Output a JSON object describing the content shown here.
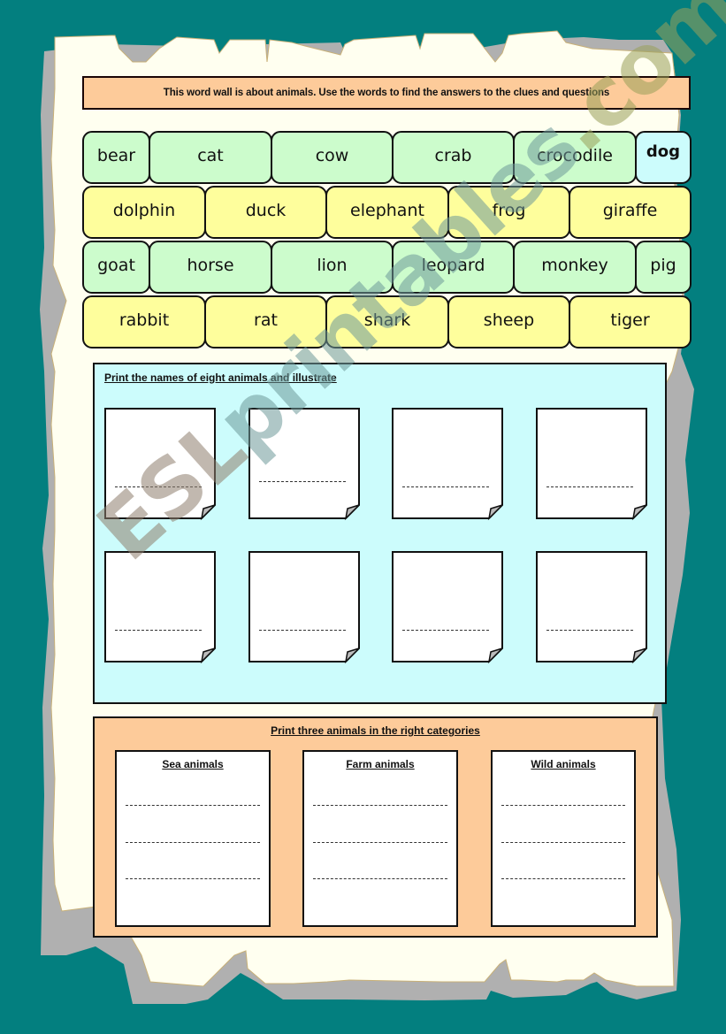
{
  "colors": {
    "background": "#037f7f",
    "parchment": "#fffff0",
    "parchment_shadow": "#b0b0b0",
    "intro_box": "#fdcb9a",
    "word_green": "#ccfccc",
    "word_yellow": "#fefe9c",
    "word_blue": "#ccfcfc",
    "illustrate_panel": "#ccfcfc",
    "category_panel": "#fdcb9a"
  },
  "intro": {
    "text": "This word wall is about animals.  Use the words to find the answers to the clues and questions"
  },
  "word_wall": {
    "rows": [
      {
        "color": "green",
        "words": [
          "bear",
          "cat",
          "cow",
          "crab",
          "crocodile",
          "dog"
        ]
      },
      {
        "color": "yellow",
        "words": [
          "dolphin",
          "duck",
          "elephant",
          "frog",
          "giraffe"
        ]
      },
      {
        "color": "green",
        "words": [
          "goat",
          "horse",
          "lion",
          "leopard",
          "monkey",
          "pig"
        ]
      },
      {
        "color": "yellow",
        "words": [
          "rabbit",
          "rat",
          "shark",
          "sheep",
          "tiger"
        ]
      }
    ]
  },
  "illustrate": {
    "title": "Print the names of eight animals and illustrate",
    "card_count": 8
  },
  "categories": {
    "title": "Print three animals in the right categories",
    "columns": [
      {
        "title": "Sea animals",
        "blank_lines": 3
      },
      {
        "title": "Farm animals",
        "blank_lines": 3
      },
      {
        "title": "Wild animals",
        "blank_lines": 3
      }
    ]
  },
  "watermark": {
    "part1": "ESL",
    "part2": "printables",
    "part3": ".com"
  }
}
